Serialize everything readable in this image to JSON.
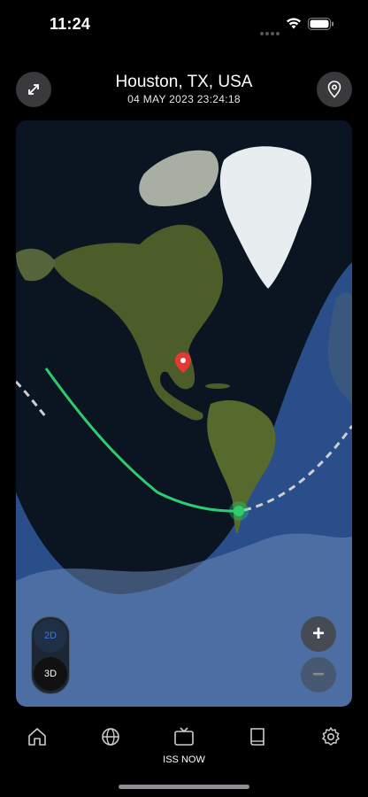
{
  "status_bar": {
    "time": "11:24"
  },
  "header": {
    "location": "Houston, TX, USA",
    "datetime": "04 MAY 2023 23:24:18"
  },
  "map": {
    "mode_toggle": {
      "option_2d": "2D",
      "option_3d": "3D",
      "selected": "3D"
    },
    "zoom_in_label": "+",
    "zoom_out_label": "−",
    "colors": {
      "night": "#0b1522",
      "day_ocean": "#2a4e8a",
      "track": "#2ecc71",
      "future_track": "#cfcfcf",
      "pin": "#e53935"
    }
  },
  "tabbar": {
    "items": [
      {
        "icon": "home-icon",
        "label": ""
      },
      {
        "icon": "globe-icon",
        "label": ""
      },
      {
        "icon": "tv-icon",
        "label": "ISS NOW",
        "active": true
      },
      {
        "icon": "book-icon",
        "label": ""
      },
      {
        "icon": "gear-icon",
        "label": ""
      }
    ]
  }
}
